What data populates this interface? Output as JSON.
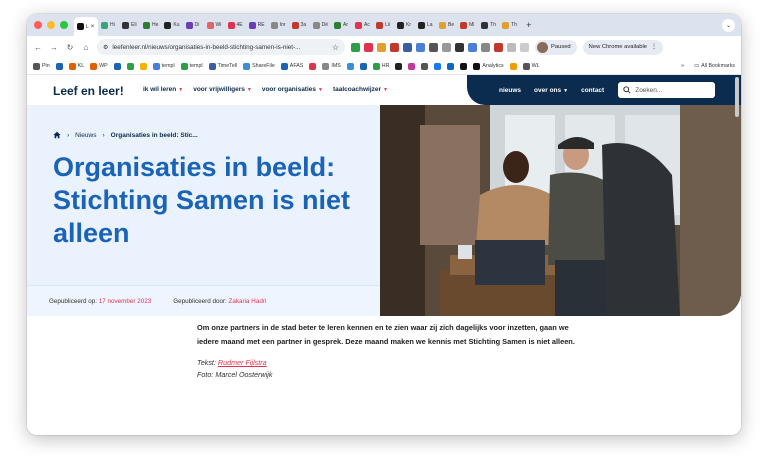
{
  "browser": {
    "tabs": [
      {
        "label": "L",
        "active": true,
        "color": "#111111"
      },
      {
        "label": "Hi",
        "color": "#3aa37a"
      },
      {
        "label": "Eli",
        "color": "#333333"
      },
      {
        "label": "He",
        "color": "#2e7d32"
      },
      {
        "label": "Ku",
        "color": "#222222"
      },
      {
        "label": "Di",
        "color": "#6a3fb5"
      },
      {
        "label": "Wi",
        "color": "#e06666"
      },
      {
        "label": "4E",
        "color": "#e0334f"
      },
      {
        "label": "RE",
        "color": "#6a3fb5"
      },
      {
        "label": "Inr",
        "color": "#888888"
      },
      {
        "label": "3a",
        "color": "#c0392b"
      },
      {
        "label": "Dé",
        "color": "#888888"
      },
      {
        "label": "Ar",
        "color": "#2e7d32"
      },
      {
        "label": "Ac",
        "color": "#e0334f"
      },
      {
        "label": "Lii",
        "color": "#c0392b"
      },
      {
        "label": "Kr",
        "color": "#222222"
      },
      {
        "label": "La",
        "color": "#222222"
      },
      {
        "label": "Be",
        "color": "#e0a030"
      },
      {
        "label": "Mi",
        "color": "#c0392b"
      },
      {
        "label": "Th",
        "color": "#333333"
      },
      {
        "label": "Th",
        "color": "#e0a030"
      }
    ],
    "tab_plus": "+",
    "url": "leefenleer.nl/nieuws/organisaties-in-beeld-stichting-samen-is-niet-...",
    "paused_label": "Paused",
    "new_chrome_label": "New Chrome available",
    "bookmarks": [
      {
        "label": "Pin",
        "color": "#555555"
      },
      {
        "label": "",
        "color": "#1a63b7"
      },
      {
        "label": "KL",
        "color": "#e06000"
      },
      {
        "label": "WP",
        "color": "#e06000"
      },
      {
        "label": "",
        "color": "#1a63b7"
      },
      {
        "label": "",
        "color": "#2e9e48"
      },
      {
        "label": "",
        "color": "#f0b400"
      },
      {
        "label": "templ",
        "color": "#4a7fd8"
      },
      {
        "label": "templ",
        "color": "#2e9e48"
      },
      {
        "label": "TimeTell",
        "color": "#3a5fa0"
      },
      {
        "label": "ShareFile",
        "color": "#3a8fd8"
      },
      {
        "label": "AFAS",
        "color": "#1a63b7"
      },
      {
        "label": "",
        "color": "#e0334f"
      },
      {
        "label": "IMS",
        "color": "#888888"
      },
      {
        "label": "",
        "color": "#3a8fd8"
      },
      {
        "label": "",
        "color": "#1a63b7"
      },
      {
        "label": "HR",
        "color": "#2e9e48"
      },
      {
        "label": "",
        "color": "#222222"
      },
      {
        "label": "",
        "color": "#c2399e"
      },
      {
        "label": "",
        "color": "#555555"
      },
      {
        "label": "",
        "color": "#1877f2"
      },
      {
        "label": "",
        "color": "#0a66c2"
      },
      {
        "label": "",
        "color": "#111111"
      },
      {
        "label": "Analytics",
        "color": "#111111"
      },
      {
        "label": "",
        "color": "#f0a000"
      },
      {
        "label": "WL",
        "color": "#555555"
      }
    ],
    "bookmarks_more": "»",
    "all_bookmarks": "All Bookmarks"
  },
  "site": {
    "logo": "Leef en leer!",
    "nav": [
      {
        "label": "ik wil leren",
        "dropdown": true
      },
      {
        "label": "voor vrijwilligers",
        "dropdown": true
      },
      {
        "label": "voor organisaties",
        "dropdown": true
      },
      {
        "label": "taalcoachwijzer",
        "dropdown": true
      }
    ],
    "dark_nav": [
      {
        "label": "nieuws",
        "dropdown": false
      },
      {
        "label": "over ons",
        "dropdown": true
      },
      {
        "label": "contact",
        "dropdown": false
      }
    ],
    "search_placeholder": "Zoeken...",
    "colors": {
      "navy": "#0b2b4f",
      "blue": "#1a63b7",
      "accent": "#e0334f",
      "hero_bg": "#e9f2fd"
    }
  },
  "article": {
    "breadcrumbs": [
      "Nieuws",
      "Organisaties in beeld: Stic..."
    ],
    "title": "Organisaties in beeld: Stichting Samen is niet alleen",
    "published_label": "Gepubliceerd op:",
    "published_date": "17 november 2023",
    "author_label": "Gepubliceerd door:",
    "author": "Zakaria Hadri",
    "lead": "Om onze partners in de stad beter te leren kennen en te zien waar zij zich dagelijks voor inzetten, gaan we iedere maand met een partner in gesprek. Deze maand maken we kennis met Stichting Samen is niet alleen.",
    "text_label": "Tekst:",
    "text_author": "Rudmer Fijlstra",
    "photo_credit": "Foto: Marcel Oosterwijk"
  }
}
